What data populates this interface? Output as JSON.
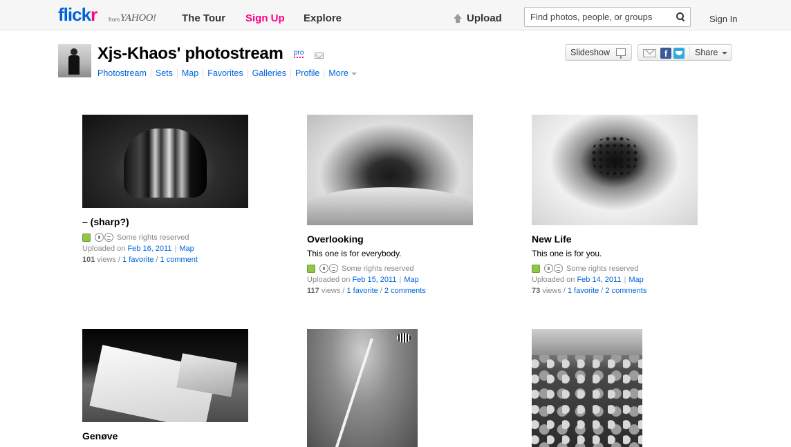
{
  "header": {
    "logo_fl": "flick",
    "logo_r": "r",
    "logo_from": "from",
    "logo_yahoo": "YAHOO!",
    "nav": {
      "tour": "The Tour",
      "signup": "Sign Up",
      "explore": "Explore"
    },
    "upload": "Upload",
    "search_placeholder": "Find photos, people, or groups",
    "signin": "Sign In"
  },
  "profile": {
    "title": "Xjs-Khaos' photostream",
    "pro": "pro",
    "subnav": {
      "photostream": "Photostream",
      "sets": "Sets",
      "map": "Map",
      "favorites": "Favorites",
      "galleries": "Galleries",
      "profile": "Profile",
      "more": "More"
    },
    "slideshow": "Slideshow",
    "share": "Share",
    "fb": "f"
  },
  "photos": [
    {
      "title": "– (sharp?)",
      "desc": "",
      "rights": "Some rights reserved",
      "uploaded_prefix": "Uploaded on",
      "date": "Feb 16, 2011",
      "map": "Map",
      "views": "101",
      "views_label": "views /",
      "favorites": "1 favorite",
      "comments": "1 comment"
    },
    {
      "title": "Overlooking",
      "desc": "This one is for everybody.",
      "rights": "Some rights reserved",
      "uploaded_prefix": "Uploaded on",
      "date": "Feb 15, 2011",
      "map": "Map",
      "views": "117",
      "views_label": "views /",
      "favorites": "1 favorite",
      "comments": "2 comments"
    },
    {
      "title": "New Life",
      "desc": "This one is for you.",
      "rights": "Some rights reserved",
      "uploaded_prefix": "Uploaded on",
      "date": "Feb 14, 2011",
      "map": "Map",
      "views": "73",
      "views_label": "views /",
      "favorites": "1 favorite",
      "comments": "2 comments"
    },
    {
      "title": "Genøve"
    },
    {
      "title": ""
    },
    {
      "title": ""
    }
  ],
  "colors": {
    "flickr_blue": "#0063dc",
    "flickr_pink": "#ff0084"
  }
}
